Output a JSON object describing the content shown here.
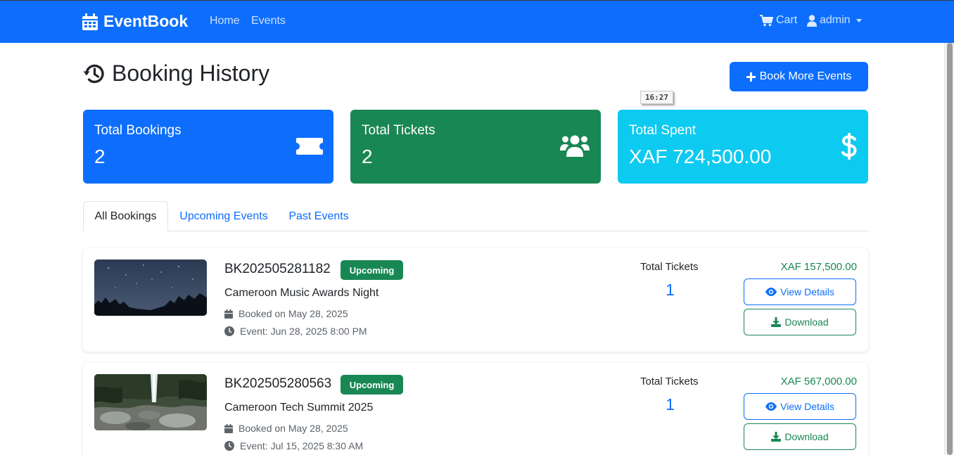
{
  "nav": {
    "brand": "EventBook",
    "links": [
      "Home",
      "Events"
    ],
    "cart": "Cart",
    "user": "admin"
  },
  "page": {
    "title": "Booking History",
    "book_more": "Book More Events",
    "time_tooltip": "16:27"
  },
  "stats": [
    {
      "label": "Total Bookings",
      "value": "2",
      "color": "#0d6efd",
      "icon": "ticket-icon"
    },
    {
      "label": "Total Tickets",
      "value": "2",
      "color": "#198754",
      "icon": "users-icon"
    },
    {
      "label": "Total Spent",
      "value": "XAF 724,500.00",
      "color": "#0dcaf0",
      "icon": "dollar-icon"
    }
  ],
  "tabs": [
    "All Bookings",
    "Upcoming Events",
    "Past Events"
  ],
  "bookings": [
    {
      "code": "BK202505281182",
      "status": "Upcoming",
      "event": "Cameroon Music Awards Night",
      "booked_on": "Booked on May 28, 2025",
      "event_time": "Event: Jun 28, 2025 8:00 PM",
      "tickets_label": "Total Tickets",
      "tickets": "1",
      "price": "XAF 157,500.00",
      "view": "View Details",
      "download": "Download"
    },
    {
      "code": "BK202505280563",
      "status": "Upcoming",
      "event": "Cameroon Tech Summit 2025",
      "booked_on": "Booked on May 28, 2025",
      "event_time": "Event: Jul 15, 2025 8:30 AM",
      "tickets_label": "Total Tickets",
      "tickets": "1",
      "price": "XAF 567,000.00",
      "view": "View Details",
      "download": "Download"
    }
  ]
}
